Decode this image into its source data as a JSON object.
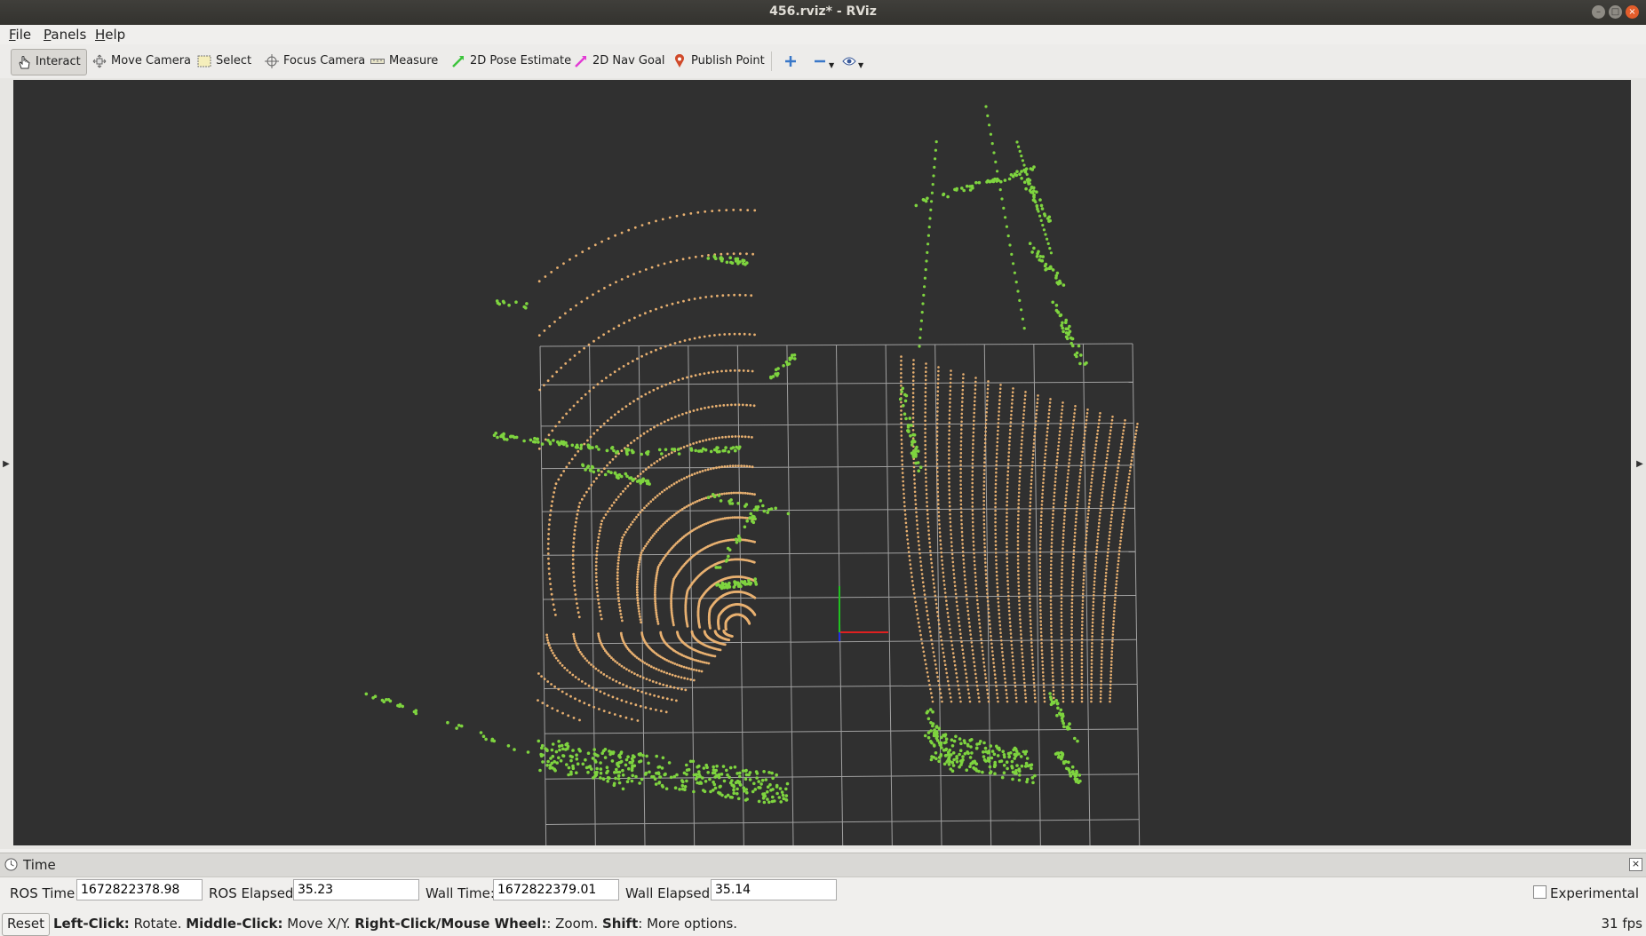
{
  "window": {
    "title": "456.rviz* - RViz"
  },
  "menu": {
    "items": [
      {
        "label": "File",
        "mnemonic": "F",
        "rest": "ile"
      },
      {
        "label": "Panels",
        "mnemonic": "P",
        "rest": "anels"
      },
      {
        "label": "Help",
        "mnemonic": "H",
        "rest": "elp"
      }
    ]
  },
  "toolbar": {
    "tools": [
      {
        "label": "Interact",
        "icon": "hand-icon"
      },
      {
        "label": "Move Camera",
        "icon": "move-camera-icon"
      },
      {
        "label": "Select",
        "icon": "select-box-icon"
      },
      {
        "label": "Focus Camera",
        "icon": "focus-crosshair-icon"
      },
      {
        "label": "Measure",
        "icon": "ruler-icon"
      },
      {
        "label": "2D Pose Estimate",
        "icon": "green-arrow-icon"
      },
      {
        "label": "2D Nav Goal",
        "icon": "pink-arrow-icon"
      },
      {
        "label": "Publish Point",
        "icon": "map-pin-icon"
      }
    ],
    "active_tool": "Interact"
  },
  "time_panel": {
    "title": "Time",
    "ros_time_label": "ROS Time:",
    "ros_time": "1672822378.98",
    "ros_elapsed_label": "ROS Elapsed:",
    "ros_elapsed": "35.23",
    "wall_time_label": "Wall Time:",
    "wall_time": "1672822379.01",
    "wall_elapsed_label": "Wall Elapsed:",
    "wall_elapsed": "35.14",
    "experimental_label": "Experimental"
  },
  "status": {
    "reset_label": "Reset",
    "hint": [
      {
        "bold": "Left-Click:",
        "text": " Rotate. "
      },
      {
        "bold": "Middle-Click:",
        "text": " Move X/Y. "
      },
      {
        "bold": "Right-Click/Mouse Wheel:",
        "text": ": Zoom. "
      },
      {
        "bold": "Shift",
        "text": ": More options."
      }
    ],
    "fps": "31 fps"
  },
  "colors": {
    "viewport_bg": "#303030",
    "grid": "#a0a0a0",
    "green_points": "#7ed43f",
    "orange_points": "#e8b070",
    "axis_x": "#e02020",
    "axis_y": "#20c020",
    "axis_z": "#2030e0"
  }
}
